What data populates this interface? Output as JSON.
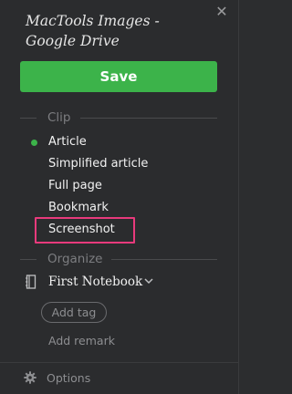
{
  "header": {
    "title": "MacTools Images - Google Drive",
    "close_glyph": "✕"
  },
  "save": {
    "label": "Save",
    "color": "#3cb34a"
  },
  "clip": {
    "heading": "Clip",
    "items": [
      {
        "label": "Article",
        "selected": true
      },
      {
        "label": "Simplified article",
        "selected": false
      },
      {
        "label": "Full page",
        "selected": false
      },
      {
        "label": "Bookmark",
        "selected": false
      },
      {
        "label": "Screenshot",
        "selected": false,
        "highlighted": true
      }
    ],
    "highlight_color": "#e83a7c"
  },
  "organize": {
    "heading": "Organize",
    "notebook": {
      "label": "First Notebook",
      "icon": "notebook-icon"
    },
    "add_tag": "Add tag",
    "add_remark": "Add remark"
  },
  "footer": {
    "options_label": "Options",
    "icon": "gear-icon"
  }
}
